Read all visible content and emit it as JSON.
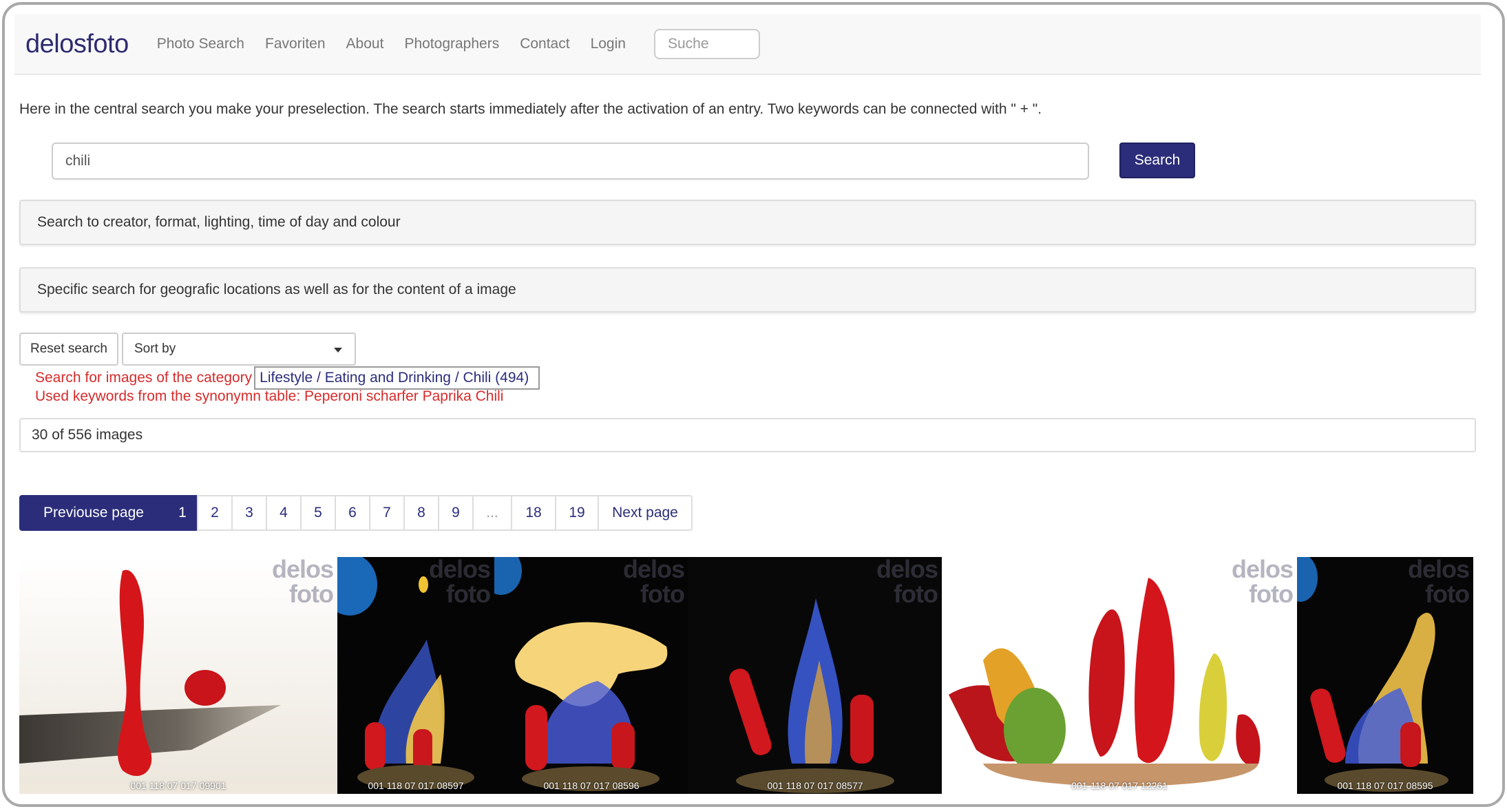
{
  "brand": {
    "part1": "delos",
    "part2": "foto"
  },
  "nav": {
    "items": [
      "Photo Search",
      "Favoriten",
      "About",
      "Photographers",
      "Contact",
      "Login"
    ],
    "search_placeholder": "Suche"
  },
  "intro_text": "Here in the central search you make your preselection. The search starts immediately after the activation of an entry. Two keywords can be connected with \" + \".",
  "search": {
    "value": "chili",
    "button_label": "Search"
  },
  "panels": {
    "advanced": "Search to creator, format, lighting, time of day and colour",
    "geo": "Specific search for geografic locations as well as for the content of a image"
  },
  "controls": {
    "reset_label": "Reset search",
    "sort_label": "Sort by"
  },
  "category": {
    "prefix": "Search for images of the category",
    "link": "Lifestyle / Eating and Drinking / Chili (494)"
  },
  "keywords": "Used keywords from the synonymn table: Peperoni scharfer Paprika Chili",
  "result_count": "30 of 556 images",
  "pagination": {
    "prev": "Previouse page",
    "pages": [
      "1",
      "2",
      "3",
      "4",
      "5",
      "6",
      "7",
      "8",
      "9",
      "...",
      "18",
      "19"
    ],
    "next": "Next page",
    "active": "1"
  },
  "watermark": {
    "line1": "delos",
    "line2": "foto"
  },
  "images": [
    {
      "id": "001 118 07 017 09901"
    },
    {
      "id": "001 118 07 017 08597"
    },
    {
      "id": "001 118 07 017 08596"
    },
    {
      "id": "001 118 07 017 08577"
    },
    {
      "id": "001-118 07 017 12261"
    },
    {
      "id": "001 118 07 017 08595"
    }
  ],
  "colors": {
    "primary": "#2b2d7a",
    "alert": "#d62b2b"
  }
}
